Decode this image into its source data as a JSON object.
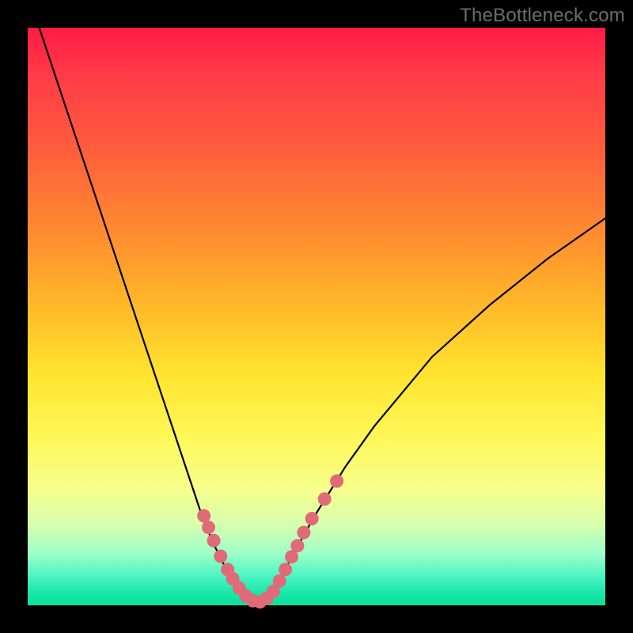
{
  "watermark": "TheBottleneck.com",
  "colors": {
    "frame": "#000000",
    "marker": "#e06a77",
    "curve": "#000000"
  },
  "chart_data": {
    "type": "line",
    "title": "",
    "xlabel": "",
    "ylabel": "",
    "xlim": [
      0,
      100
    ],
    "ylim": [
      0,
      100
    ],
    "series": [
      {
        "name": "bottleneck-curve",
        "x": [
          2,
          6,
          10,
          14,
          18,
          22,
          26,
          28,
          30,
          32,
          34,
          36,
          37,
          38,
          39,
          40,
          41,
          42,
          44,
          46,
          50,
          55,
          60,
          65,
          70,
          80,
          90,
          100
        ],
        "y": [
          100,
          88,
          76,
          64,
          52,
          40,
          28,
          22,
          16,
          11,
          7,
          4,
          2,
          1,
          0.5,
          0.5,
          1,
          2,
          5,
          9,
          16,
          24,
          31,
          37,
          43,
          52,
          60,
          67
        ]
      }
    ],
    "markers": {
      "name": "highlighted-points",
      "coords": [
        [
          30.5,
          15.5
        ],
        [
          31.3,
          13.5
        ],
        [
          32.2,
          11.2
        ],
        [
          33.4,
          8.5
        ],
        [
          34.6,
          6.2
        ],
        [
          35.5,
          4.6
        ],
        [
          36.6,
          3.0
        ],
        [
          37.8,
          1.6
        ],
        [
          39.0,
          0.8
        ],
        [
          40.2,
          0.6
        ],
        [
          41.4,
          1.2
        ],
        [
          42.5,
          2.4
        ],
        [
          43.6,
          4.2
        ],
        [
          44.6,
          6.2
        ],
        [
          45.7,
          8.4
        ],
        [
          46.7,
          10.3
        ],
        [
          47.8,
          12.6
        ],
        [
          49.2,
          15.0
        ],
        [
          51.4,
          18.4
        ],
        [
          53.5,
          21.5
        ]
      ]
    }
  }
}
